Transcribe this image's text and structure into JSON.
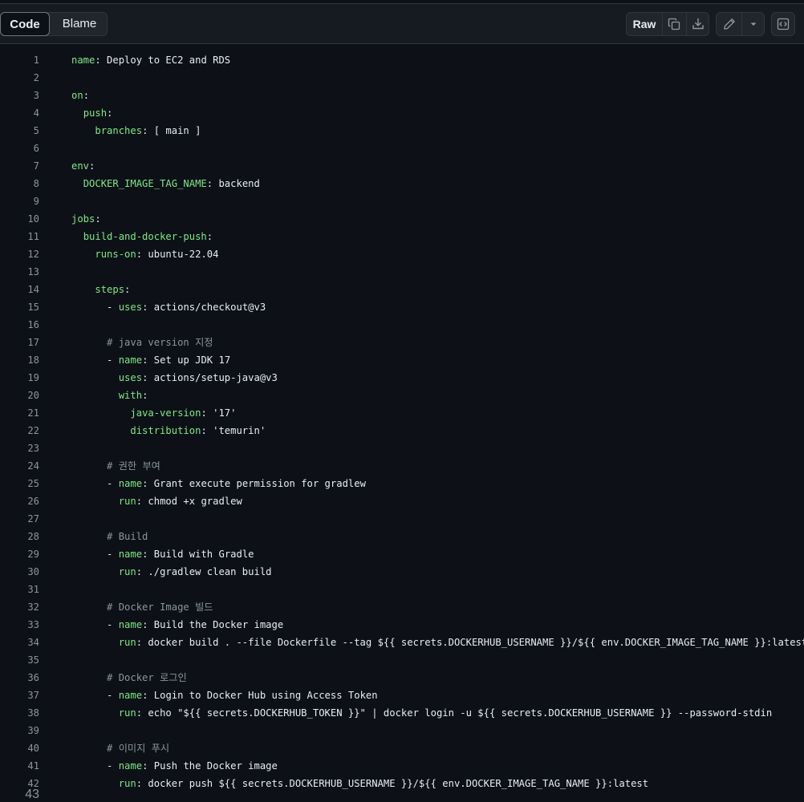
{
  "toolbar": {
    "code_tab": "Code",
    "blame_tab": "Blame",
    "raw_label": "Raw",
    "icons": [
      "copy-icon",
      "download-icon",
      "pencil-icon",
      "triangle-down-icon",
      "code-symbol-icon"
    ]
  },
  "colors": {
    "key": "#7ee787",
    "value": "#a5d6ff",
    "comment": "#8b949e",
    "text": "#e6edf3",
    "background": "#0d1117"
  },
  "lines": [
    {
      "n": "1",
      "key": "name",
      "val": "Deploy to EC2 and RDS",
      "indent": 0
    },
    {
      "n": "2"
    },
    {
      "n": "3",
      "key": "on",
      "indent": 0
    },
    {
      "n": "4",
      "key": "push",
      "indent": 2
    },
    {
      "n": "5",
      "key": "branches",
      "val": "[ main ]",
      "indent": 4
    },
    {
      "n": "6"
    },
    {
      "n": "7",
      "key": "env",
      "indent": 0
    },
    {
      "n": "8",
      "key": "DOCKER_IMAGE_TAG_NAME",
      "val": "backend",
      "indent": 2
    },
    {
      "n": "9"
    },
    {
      "n": "10",
      "key": "jobs",
      "indent": 0
    },
    {
      "n": "11",
      "key": "build-and-docker-push",
      "indent": 2
    },
    {
      "n": "12",
      "key": "runs-on",
      "val": "ubuntu-22.04",
      "indent": 4
    },
    {
      "n": "13"
    },
    {
      "n": "14",
      "key": "steps",
      "indent": 4
    },
    {
      "n": "15",
      "dash": true,
      "key": "uses",
      "val": "actions/checkout@v3",
      "indent": 6
    },
    {
      "n": "16"
    },
    {
      "n": "17",
      "comment": "# java version 지정",
      "indent": 6
    },
    {
      "n": "18",
      "dash": true,
      "key": "name",
      "val": "Set up JDK 17",
      "indent": 6
    },
    {
      "n": "19",
      "key": "uses",
      "val": "actions/setup-java@v3",
      "indent": 8
    },
    {
      "n": "20",
      "key": "with",
      "indent": 8
    },
    {
      "n": "21",
      "key": "java-version",
      "val": "'17'",
      "indent": 10
    },
    {
      "n": "22",
      "key": "distribution",
      "val": "'temurin'",
      "indent": 10
    },
    {
      "n": "23"
    },
    {
      "n": "24",
      "comment": "# 권한 부여",
      "indent": 6
    },
    {
      "n": "25",
      "dash": true,
      "key": "name",
      "val": "Grant execute permission for gradlew",
      "indent": 6
    },
    {
      "n": "26",
      "key": "run",
      "val": "chmod +x gradlew",
      "indent": 8
    },
    {
      "n": "27"
    },
    {
      "n": "28",
      "comment": "# Build",
      "indent": 6
    },
    {
      "n": "29",
      "dash": true,
      "key": "name",
      "val": "Build with Gradle",
      "indent": 6
    },
    {
      "n": "30",
      "key": "run",
      "val": "./gradlew clean build",
      "indent": 8
    },
    {
      "n": "31"
    },
    {
      "n": "32",
      "comment": "# Docker Image 빌드",
      "indent": 6
    },
    {
      "n": "33",
      "dash": true,
      "key": "name",
      "val": "Build the Docker image",
      "indent": 6
    },
    {
      "n": "34",
      "key": "run",
      "val": "docker build . --file Dockerfile --tag ${{ secrets.DOCKERHUB_USERNAME }}/${{ env.DOCKER_IMAGE_TAG_NAME }}:latest",
      "indent": 8
    },
    {
      "n": "35"
    },
    {
      "n": "36",
      "comment": "# Docker 로그인",
      "indent": 6
    },
    {
      "n": "37",
      "dash": true,
      "key": "name",
      "val": "Login to Docker Hub using Access Token",
      "indent": 6
    },
    {
      "n": "38",
      "key": "run",
      "val": "echo \"${{ secrets.DOCKERHUB_TOKEN }}\" | docker login -u ${{ secrets.DOCKERHUB_USERNAME }} --password-stdin",
      "indent": 8
    },
    {
      "n": "39"
    },
    {
      "n": "40",
      "comment": "# 이미지 푸시",
      "indent": 6
    },
    {
      "n": "41",
      "dash": true,
      "key": "name",
      "val": "Push the Docker image",
      "indent": 6
    },
    {
      "n": "42",
      "key": "run",
      "val": "docker push ${{ secrets.DOCKERHUB_USERNAME }}/${{ env.DOCKER_IMAGE_TAG_NAME }}:latest",
      "indent": 8
    }
  ],
  "cut_line_number": "43"
}
